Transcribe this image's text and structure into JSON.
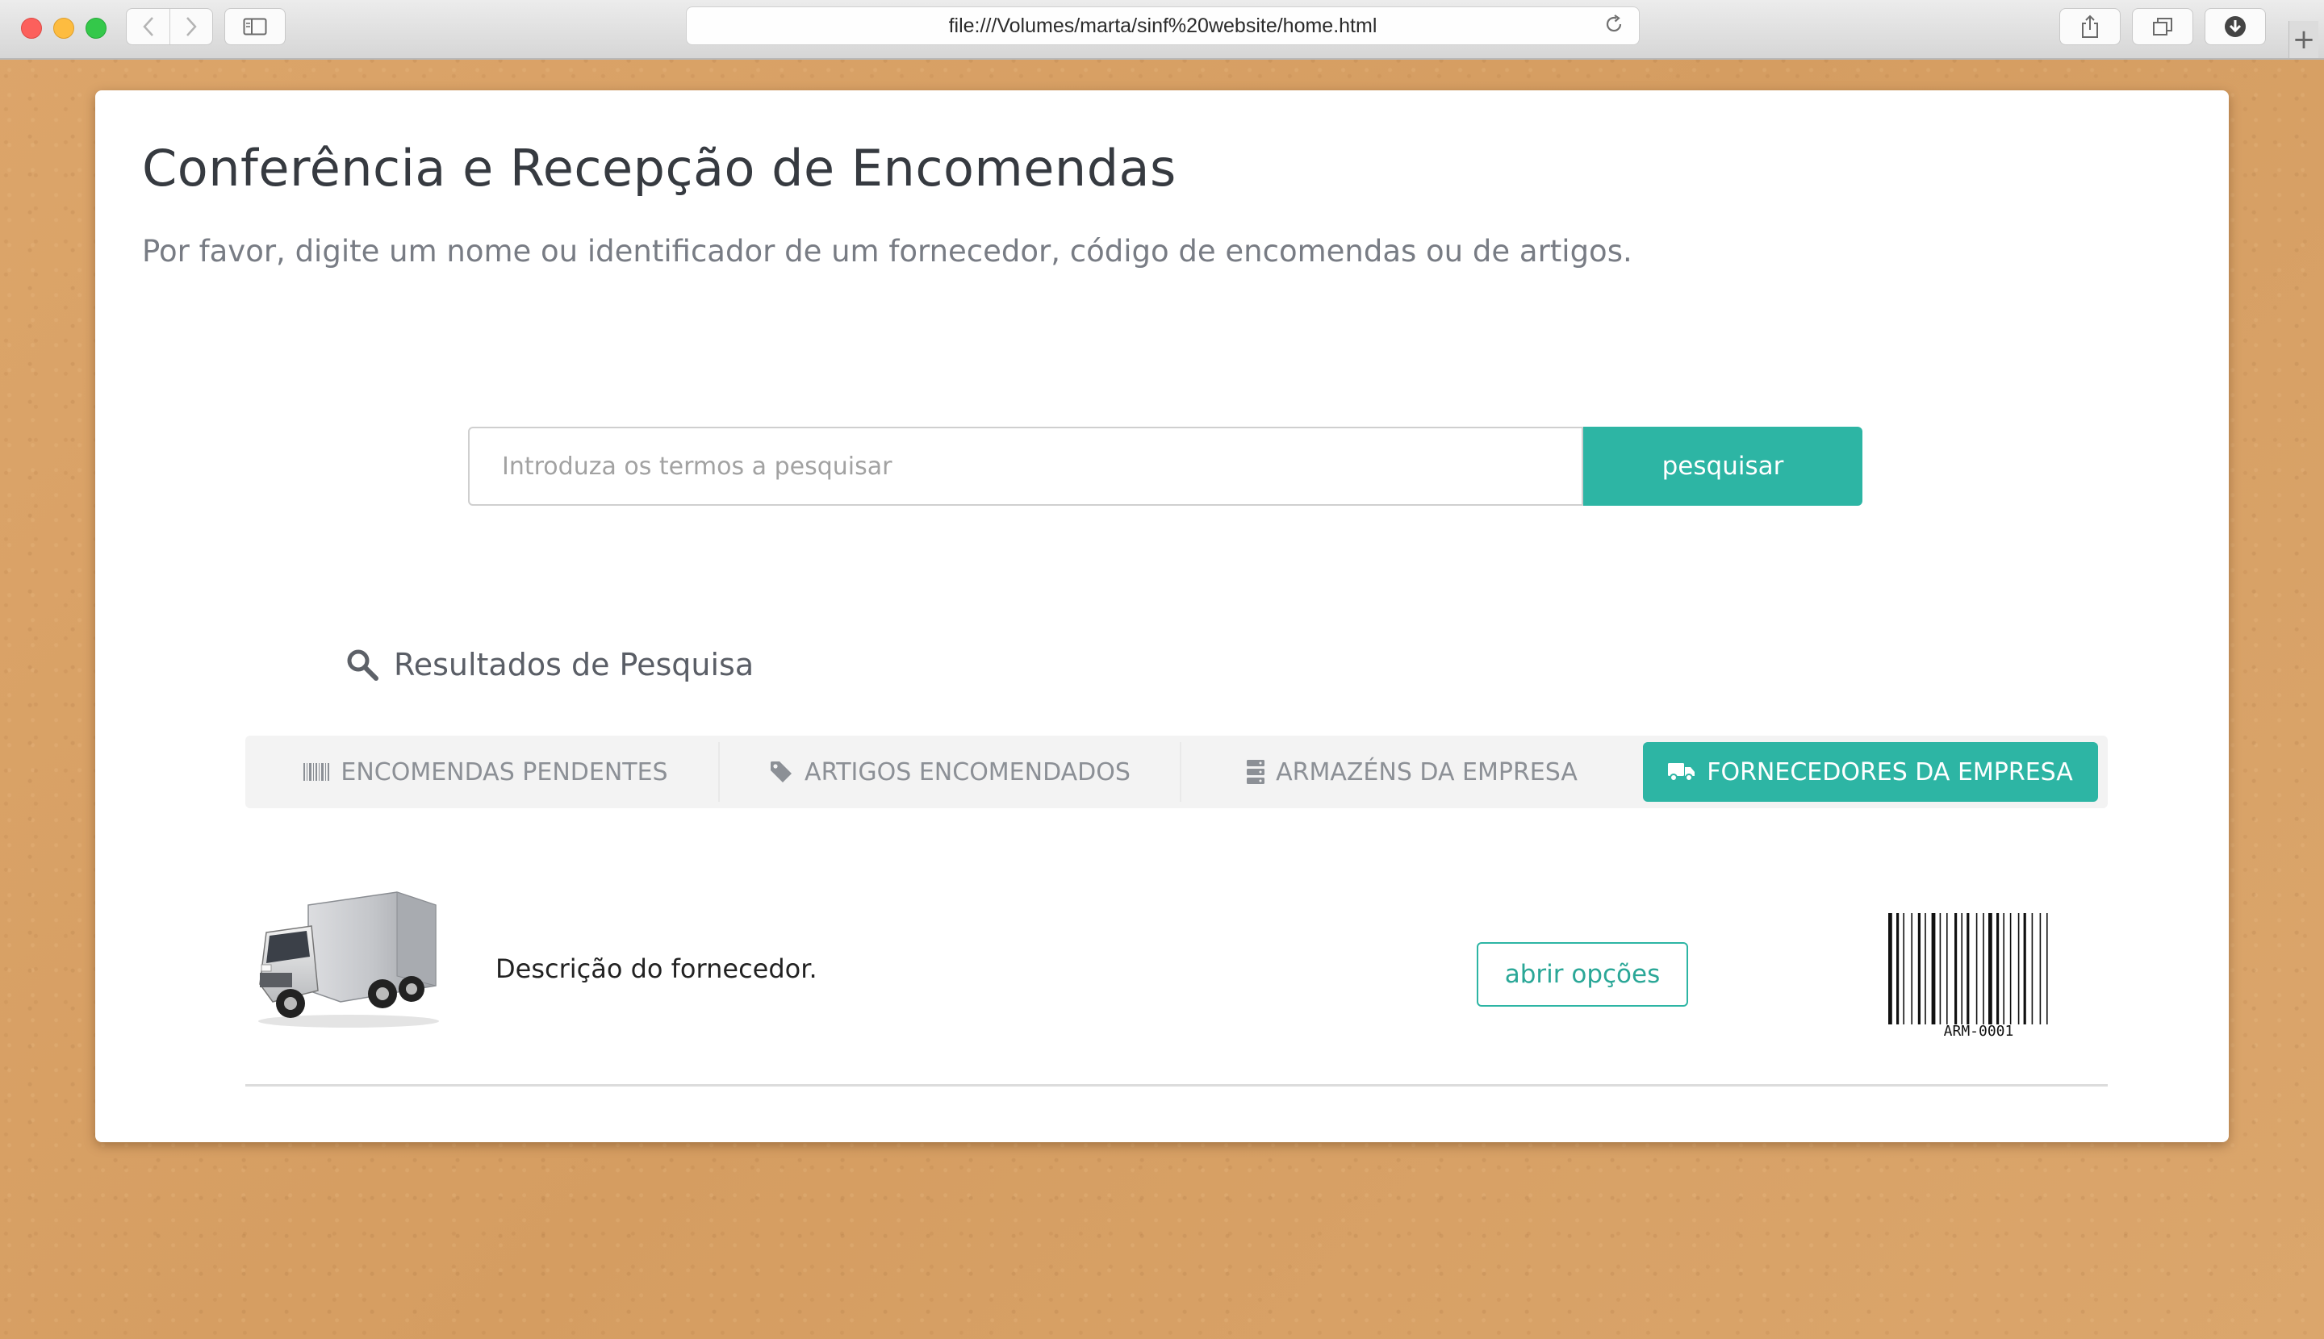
{
  "browser": {
    "url": "file:///Volumes/marta/sinf%20website/home.html"
  },
  "page": {
    "title": "Conferência e Recepção de Encomendas",
    "subtitle": "Por favor, digite um nome ou identificador de um fornecedor, código de encomendas ou de artigos."
  },
  "search": {
    "placeholder": "Introduza os termos a pesquisar",
    "value": "",
    "button_label": "pesquisar"
  },
  "results": {
    "heading": "Resultados de Pesquisa",
    "tabs": [
      {
        "label": "ENCOMENDAS PENDENTES",
        "icon": "barcode-icon",
        "active": false
      },
      {
        "label": "ARTIGOS ENCOMENDADOS",
        "icon": "tag-icon",
        "active": false
      },
      {
        "label": "ARMAZÉNS DA EMPRESA",
        "icon": "server-icon",
        "active": false
      },
      {
        "label": "FORNECEDORES DA EMPRESA",
        "icon": "truck-icon",
        "active": true
      }
    ],
    "items": [
      {
        "description": "Descrição do fornecedor.",
        "button_label": "abrir opções",
        "barcode": "ARM-0001"
      }
    ]
  },
  "colors": {
    "accent": "#2db5a4",
    "background": "#d9a267"
  }
}
